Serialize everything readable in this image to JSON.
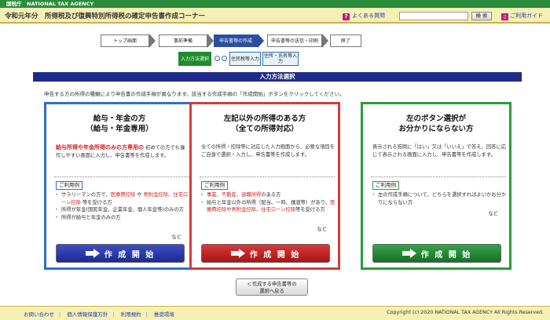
{
  "topbar": {
    "agency": "国税庁　NATIONAL TAX AGENCY"
  },
  "header": {
    "title": "令和元年分　所得税及び復興特別所得税の確定申告書作成コーナー",
    "faq_label": "よくある質問",
    "search_button": "検 索",
    "guide_label": "ご利用ガイド"
  },
  "steps": [
    {
      "label": "トップ画面"
    },
    {
      "label": "事前準備"
    },
    {
      "label": "申告書等の作成"
    },
    {
      "label": "申告書等の送信・印刷"
    },
    {
      "label": "終了"
    }
  ],
  "substeps": [
    {
      "label": "入力方法選択"
    },
    {
      "label": "住民税等入力"
    },
    {
      "label": "住所・氏名等入力"
    }
  ],
  "banner": "入力方法選択",
  "instruction": "申告する方の所得の種類により申告書の作成手順が異なります。該当する作成手順の「作成開始」ボタンをクリックしてください。",
  "panels": [
    {
      "title1": "給与・年金の方",
      "title2": "（給与・年金専用）",
      "desc_red": "給与所得や年金所得のみの方専用の",
      "desc": "初めての方でも操作しやすい画面に入力し、申告書等を作成します。",
      "tag": "ご利用例",
      "bullets": [
        {
          "pre": "サラリーマンの方で、",
          "red": "医療費控除",
          "mid": " や ",
          "red2": "寄附金控除",
          "mid2": "、",
          "red3": "住宅ローン控除",
          "post": " 等を受ける方"
        },
        {
          "text": "所得が年金(国民年金、企業年金、個人年金等)のみの方"
        },
        {
          "text": "所得が給与と年金のみの方"
        }
      ],
      "nado": "など",
      "button": "作 成 開 始"
    },
    {
      "title1": "左記以外の所得のある方",
      "title2": "（全ての所得対応）",
      "desc": "全ての所得・控除等に対応した入力画面から、必要な項目をご自身で選択・入力し、申告書等を作成します。",
      "tag": "ご利用例",
      "bullets": [
        {
          "red": "事業、不動産、退職所得",
          "post": "のある方"
        },
        {
          "pre": "給与と年金以外の所得（配当、一時、譲渡等）があり、",
          "red": "医療費控除",
          "mid": "や",
          "red2": "寄附金控除",
          "mid2": "、",
          "red3": "住宅ローン控除",
          "post": "等を受ける方"
        }
      ],
      "nado": "など",
      "button": "作 成 開 始"
    },
    {
      "title1": "左のボタン選択が",
      "title2": "お分かりにならない方",
      "desc": "表示される質問に「はい」又は「いいえ」で答え、回答に応じて表示される画面に入力し、申告書等を作成します。",
      "tag": "ご利用例",
      "bullets": [
        {
          "text": "左の作成手順について、どちらを選択すればよいかお分かりにならない方"
        }
      ],
      "nado": "など",
      "button": "作 成 開 始"
    }
  ],
  "back_button": {
    "line1": "＜作成する申告書等の",
    "line2": "選択へ戻る"
  },
  "footer": {
    "links": [
      "お問い合わせ",
      "個人情報保護方針",
      "利用規約",
      "推奨環境"
    ],
    "copyright": "Copyright (c) 2020 NATIONAL TAX AGENCY All Rights Reserved."
  }
}
